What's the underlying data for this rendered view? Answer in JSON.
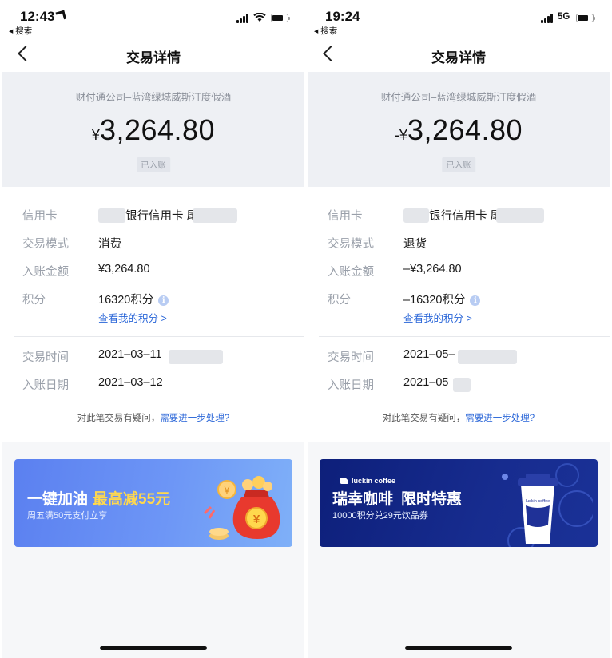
{
  "left": {
    "status": {
      "time": "12:43",
      "back_label": "◂ 搜索"
    },
    "nav": {
      "title": "交易详情"
    },
    "hero": {
      "merchant": "财付通公司–蓝湾绿城威斯汀度假酒",
      "currency": "¥",
      "amount": "3,264.80",
      "status": "已入账"
    },
    "details": {
      "card_label": "信用卡",
      "card_value": "银行信用卡 尾",
      "mode_label": "交易模式",
      "mode_value": "消费",
      "posted_label": "入账金额",
      "posted_value": "¥3,264.80",
      "points_label": "积分",
      "points_value": "16320积分",
      "points_link": "查看我的积分 >",
      "time_label": "交易时间",
      "time_value": "2021–03–11",
      "date_label": "入账日期",
      "date_value": "2021–03–12"
    },
    "question": {
      "text": "对此笔交易有疑问，",
      "link": "需要进一步处理?"
    },
    "ad": {
      "title": "一键加油",
      "highlight": "最高减55元",
      "subtitle": "周五满50元支付立享"
    }
  },
  "right": {
    "status": {
      "time": "19:24",
      "back_label": "◂ 搜索",
      "network": "5G"
    },
    "nav": {
      "title": "交易详情"
    },
    "hero": {
      "merchant": "财付通公司–蓝湾绿城威斯汀度假酒",
      "currency": "-¥",
      "amount": "3,264.80",
      "status": "已入账"
    },
    "details": {
      "card_label": "信用卡",
      "card_value": "银行信用卡 尾",
      "mode_label": "交易模式",
      "mode_value": "退货",
      "posted_label": "入账金额",
      "posted_value": "–¥3,264.80",
      "points_label": "积分",
      "points_value": "–16320积分",
      "points_link": "查看我的积分 >",
      "time_label": "交易时间",
      "time_value": "2021–05–",
      "date_label": "入账日期",
      "date_value": "2021–05"
    },
    "question": {
      "text": "对此笔交易有疑问，",
      "link": "需要进一步处理?"
    },
    "ad": {
      "brand": "luckin coffee",
      "title": "瑞幸咖啡",
      "highlight": "限时特惠",
      "subtitle": "10000积分兑29元饮品券",
      "cup_text": "luckin coffee"
    }
  },
  "colors": {
    "link": "#2a66d8",
    "label": "#9aa0aa",
    "hero_bg": "#eef0f4",
    "page_bg": "#f6f7f9",
    "fuel_ad": "#6d96f6",
    "luckin_ad": "#172c8f",
    "highlight": "#ffd84d"
  }
}
